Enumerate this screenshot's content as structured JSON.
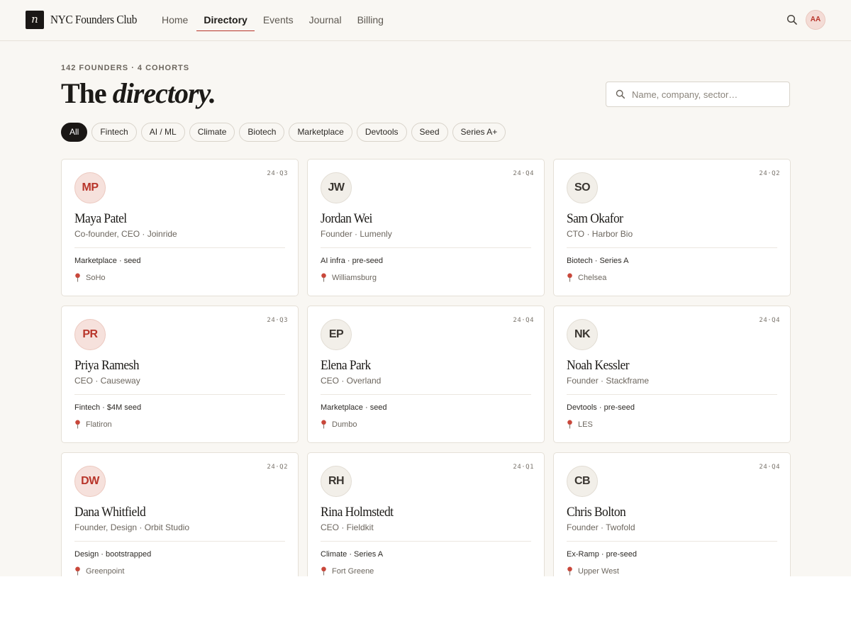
{
  "brand": {
    "logo_letter": "n",
    "name": "NYC Founders Club"
  },
  "nav": {
    "items": [
      {
        "label": "Home",
        "active": false
      },
      {
        "label": "Directory",
        "active": true
      },
      {
        "label": "Events",
        "active": false
      },
      {
        "label": "Journal",
        "active": false
      },
      {
        "label": "Billing",
        "active": false
      }
    ]
  },
  "user": {
    "initials": "AA"
  },
  "header": {
    "eyebrow": "142 FOUNDERS · 4 COHORTS",
    "title_plain": "The ",
    "title_italic": "directory."
  },
  "search": {
    "placeholder": "Name, company, sector…",
    "value": ""
  },
  "filters": {
    "chips": [
      {
        "label": "All",
        "active": true
      },
      {
        "label": "Fintech",
        "active": false
      },
      {
        "label": "AI / ML",
        "active": false
      },
      {
        "label": "Climate",
        "active": false
      },
      {
        "label": "Biotech",
        "active": false
      },
      {
        "label": "Marketplace",
        "active": false
      },
      {
        "label": "Devtools",
        "active": false
      },
      {
        "label": "Seed",
        "active": false
      },
      {
        "label": "Series A+",
        "active": false
      }
    ]
  },
  "founders": [
    {
      "initials": "MP",
      "avatar_style": "red",
      "cohort": "24·Q3",
      "name": "Maya Patel",
      "role": "Co-founder, CEO · Joinride",
      "tags": "Marketplace · seed",
      "location": "SoHo"
    },
    {
      "initials": "JW",
      "avatar_style": "neutral",
      "cohort": "24·Q4",
      "name": "Jordan Wei",
      "role": "Founder · Lumenly",
      "tags": "AI infra · pre-seed",
      "location": "Williamsburg"
    },
    {
      "initials": "SO",
      "avatar_style": "neutral",
      "cohort": "24·Q2",
      "name": "Sam Okafor",
      "role": "CTO · Harbor Bio",
      "tags": "Biotech · Series A",
      "location": "Chelsea"
    },
    {
      "initials": "PR",
      "avatar_style": "red",
      "cohort": "24·Q3",
      "name": "Priya Ramesh",
      "role": "CEO · Causeway",
      "tags": "Fintech · $4M seed",
      "location": "Flatiron"
    },
    {
      "initials": "EP",
      "avatar_style": "neutral",
      "cohort": "24·Q4",
      "name": "Elena Park",
      "role": "CEO · Overland",
      "tags": "Marketplace · seed",
      "location": "Dumbo"
    },
    {
      "initials": "NK",
      "avatar_style": "neutral",
      "cohort": "24·Q4",
      "name": "Noah Kessler",
      "role": "Founder · Stackframe",
      "tags": "Devtools · pre-seed",
      "location": "LES"
    },
    {
      "initials": "DW",
      "avatar_style": "red",
      "cohort": "24·Q2",
      "name": "Dana Whitfield",
      "role": "Founder, Design · Orbit Studio",
      "tags": "Design · bootstrapped",
      "location": "Greenpoint"
    },
    {
      "initials": "RH",
      "avatar_style": "neutral",
      "cohort": "24·Q1",
      "name": "Rina Holmstedt",
      "role": "CEO · Fieldkit",
      "tags": "Climate · Series A",
      "location": "Fort Greene"
    },
    {
      "initials": "CB",
      "avatar_style": "neutral",
      "cohort": "24·Q4",
      "name": "Chris Bolton",
      "role": "Founder · Twofold",
      "tags": "Ex-Ramp · pre-seed",
      "location": "Upper West"
    }
  ],
  "colors": {
    "accent": "#b8352a",
    "background": "#f9f7f3",
    "ink": "#1c1a17",
    "avatar_red_bg": "#f6e1dc",
    "avatar_neutral_bg": "#f2efe9"
  },
  "icons": {
    "search": "search-icon",
    "location": "map-pin-icon"
  }
}
